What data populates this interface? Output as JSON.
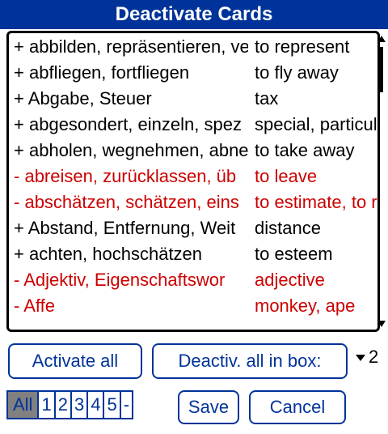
{
  "window": {
    "title": "Deactivate Cards"
  },
  "list": {
    "rows": [
      {
        "marker": "+",
        "german": "abbilden, repräsentieren, ve",
        "english": "to represent",
        "active": true
      },
      {
        "marker": "+",
        "german": "abfliegen, fortfliegen",
        "english": "to fly away",
        "active": true
      },
      {
        "marker": "+",
        "german": "Abgabe, Steuer",
        "english": "tax",
        "active": true
      },
      {
        "marker": "+",
        "german": "abgesondert, einzeln, spez",
        "english": "special, particula",
        "active": true
      },
      {
        "marker": "+",
        "german": "abholen, wegnehmen, abne",
        "english": "to take away",
        "active": true
      },
      {
        "marker": "-",
        "german": "abreisen, zurücklassen, üb",
        "english": "to leave",
        "active": false
      },
      {
        "marker": "-",
        "german": "abschätzen, schätzen, eins",
        "english": "to estimate, to r",
        "active": false
      },
      {
        "marker": "+",
        "german": "Abstand, Entfernung, Weit",
        "english": "distance",
        "active": true
      },
      {
        "marker": "+",
        "german": "achten, hochschätzen",
        "english": "to esteem",
        "active": true
      },
      {
        "marker": "-",
        "german": "Adjektiv, Eigenschaftswor",
        "english": "adjective",
        "active": false
      },
      {
        "marker": "-",
        "german": "Affe",
        "english": "monkey, ape",
        "active": false
      }
    ]
  },
  "buttons": {
    "activate_all": "Activate all",
    "deactivate_all_in_box": "Deactiv. all in box:",
    "save": "Save",
    "cancel": "Cancel"
  },
  "box_selector": {
    "value": "2"
  },
  "filter_tabs": [
    "All",
    "1",
    "2",
    "3",
    "4",
    "5",
    "-"
  ],
  "active_filter": "All",
  "colors": {
    "title_bar": "#003399",
    "accent": "#003399",
    "inactive_text": "#cc0000"
  }
}
